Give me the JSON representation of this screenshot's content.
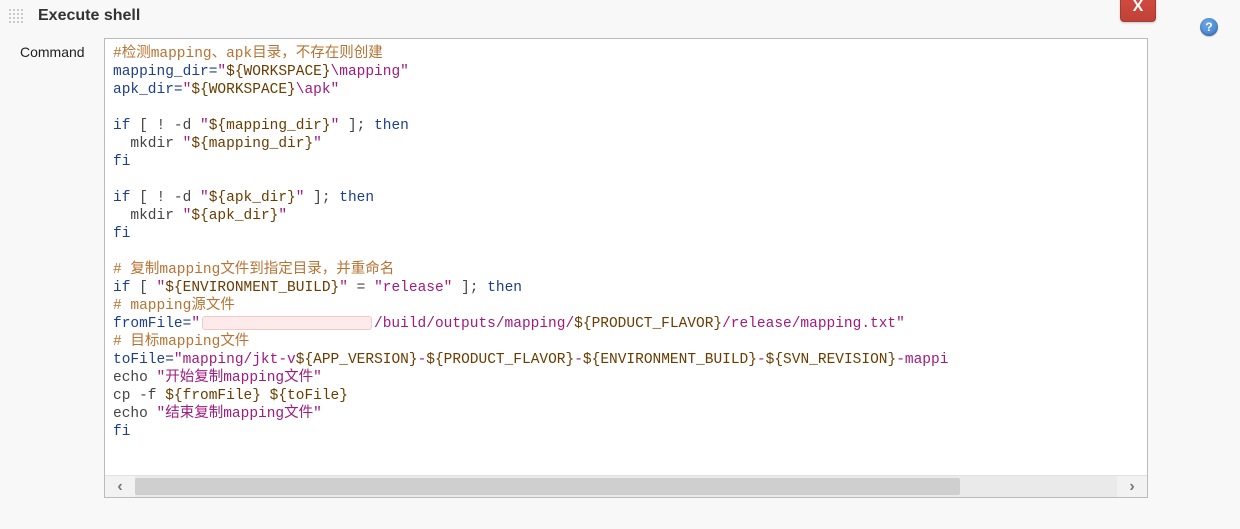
{
  "section": {
    "title": "Execute shell",
    "close_label": "X",
    "help_label": "?"
  },
  "row": {
    "label": "Command"
  },
  "code": {
    "c0_comment": "#检测mapping、apk目录，不存在则创建",
    "l1_var": "mapping_dir",
    "l1_eq": "=",
    "l1_str_a": "\"",
    "l1_str_exp": "${WORKSPACE}",
    "l1_str_b": "\\mapping\"",
    "l2_var": "apk_dir",
    "l2_eq": "=",
    "l2_str_a": "\"",
    "l2_str_exp": "${WORKSPACE}",
    "l2_str_b": "\\apk\"",
    "if1_a": "if ",
    "if1_b": "[ ! -d ",
    "if1_str_a": "\"",
    "if1_str_exp": "${mapping_dir}",
    "if1_str_b": "\"",
    "if1_c": " ]; ",
    "if1_then": "then",
    "mk1_a": "  mkdir ",
    "mk1_str_a": "\"",
    "mk1_str_exp": "${mapping_dir}",
    "mk1_str_b": "\"",
    "fi1": "fi",
    "if2_a": "if ",
    "if2_b": "[ ! -d ",
    "if2_str_a": "\"",
    "if2_str_exp": "${apk_dir}",
    "if2_str_b": "\"",
    "if2_c": " ]; ",
    "if2_then": "then",
    "mk2_a": "  mkdir ",
    "mk2_str_a": "\"",
    "mk2_str_exp": "${apk_dir}",
    "mk2_str_b": "\"",
    "fi2": "fi",
    "c1_comment": "# 复制mapping文件到指定目录，并重命名",
    "if3_a": "if ",
    "if3_b": "[ ",
    "if3_s1a": "\"",
    "if3_s1exp": "${ENVIRONMENT_BUILD}",
    "if3_s1b": "\"",
    "if3_eq": " = ",
    "if3_s2": "\"release\"",
    "if3_c": " ]; ",
    "if3_then": "then",
    "c2_comment": "# mapping源文件",
    "ff_var": "fromFile",
    "ff_eq": "=",
    "ff_str_a": "\"",
    "ff_str_mid": "/build/outputs/mapping/",
    "ff_str_exp": "${PRODUCT_FLAVOR}",
    "ff_str_b": "/release/mapping.txt\"",
    "c3_comment": "# 目标mapping文件",
    "tf_var": "toFile",
    "tf_eq": "=",
    "tf_str_a": "\"mapping/jkt-v",
    "tf_exp1": "${APP_VERSION}",
    "tf_d1": "-",
    "tf_exp2": "${PRODUCT_FLAVOR}",
    "tf_d2": "-",
    "tf_exp3": "${ENVIRONMENT_BUILD}",
    "tf_d3": "-",
    "tf_exp4": "${SVN_REVISION}",
    "tf_tail": "-mappi",
    "echo1_a": "echo ",
    "echo1_str": "\"开始复制mapping文件\"",
    "cp_a": "cp -f ",
    "cp_exp1": "${fromFile}",
    "cp_sp": " ",
    "cp_exp2": "${toFile}",
    "echo2_a": "echo ",
    "echo2_str": "\"结束复制mapping文件\"",
    "fi3": "fi"
  },
  "scrollbar": {
    "left": "‹",
    "right": "›"
  }
}
